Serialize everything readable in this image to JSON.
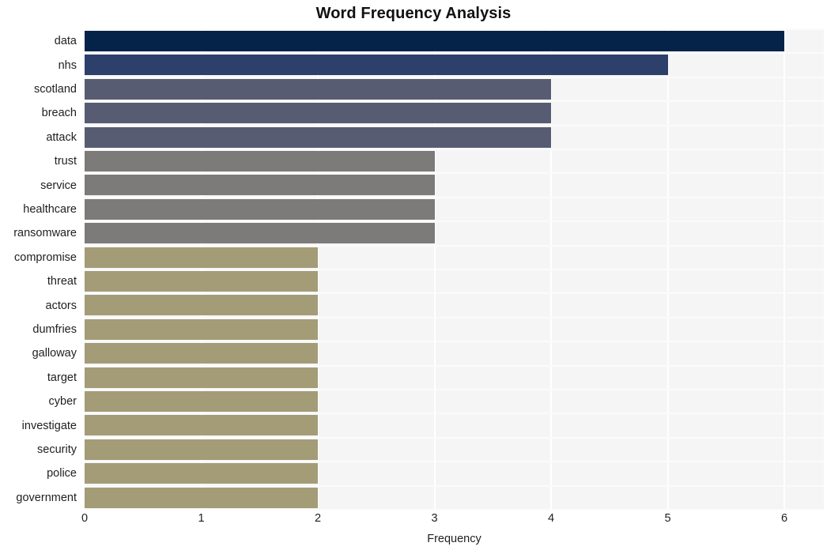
{
  "chart_data": {
    "type": "bar",
    "orientation": "horizontal",
    "title": "Word Frequency Analysis",
    "xlabel": "Frequency",
    "ylabel": "",
    "xlim": [
      0,
      6
    ],
    "ylim": [
      0,
      20
    ],
    "xticks": [
      "0",
      "1",
      "2",
      "3",
      "4",
      "5",
      "6"
    ],
    "grid": true,
    "grid_axis": "both",
    "legend": "none",
    "categories": [
      "data",
      "nhs",
      "scotland",
      "breach",
      "attack",
      "trust",
      "service",
      "healthcare",
      "ransomware",
      "compromise",
      "threat",
      "actors",
      "dumfries",
      "galloway",
      "target",
      "cyber",
      "investigate",
      "security",
      "police",
      "government"
    ],
    "values": [
      6,
      5,
      4,
      4,
      4,
      3,
      3,
      3,
      3,
      2,
      2,
      2,
      2,
      2,
      2,
      2,
      2,
      2,
      2,
      2
    ],
    "bar_colors": [
      "#052349",
      "#2d3f6b",
      "#585c72",
      "#585c72",
      "#585c72",
      "#7c7b79",
      "#7c7b79",
      "#7c7b79",
      "#7c7b79",
      "#a39c77",
      "#a39c77",
      "#a39c77",
      "#a39c77",
      "#a39c77",
      "#a39c77",
      "#a39c77",
      "#a39c77",
      "#a39c77",
      "#a39c77",
      "#a39c77"
    ],
    "plot_background": "#f5f5f6",
    "figure_background": "#ffffff",
    "gridline_color": "#ffffff"
  }
}
